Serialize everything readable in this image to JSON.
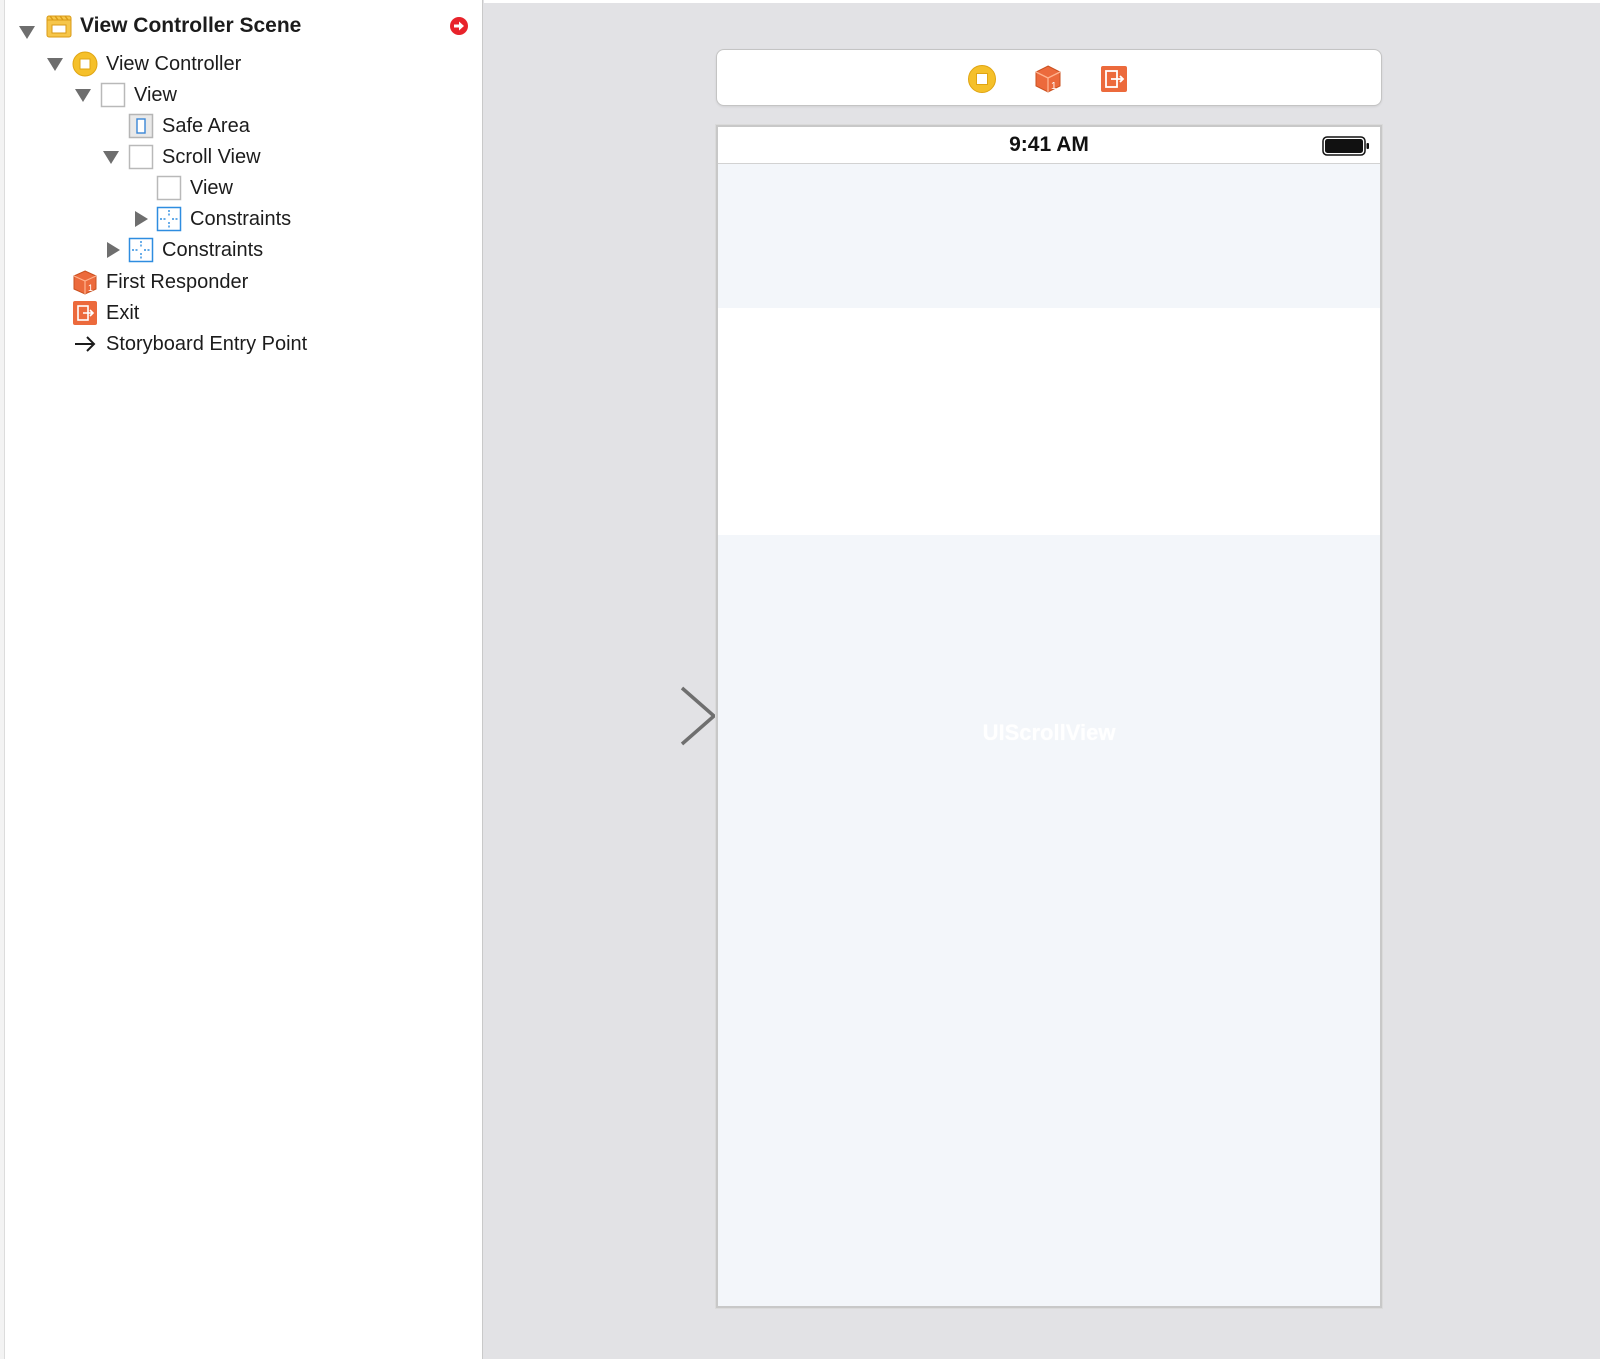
{
  "outline": {
    "scene_title": "View Controller Scene",
    "items": [
      {
        "label": "View Controller",
        "icon": "view-controller-icon"
      },
      {
        "label": "View",
        "icon": "view-icon"
      },
      {
        "label": "Safe Area",
        "icon": "safe-area-icon"
      },
      {
        "label": "Scroll View",
        "icon": "scroll-view-icon"
      },
      {
        "label": "View",
        "icon": "view-icon"
      },
      {
        "label": "Constraints",
        "icon": "constraints-icon"
      },
      {
        "label": "Constraints",
        "icon": "constraints-icon"
      },
      {
        "label": "First Responder",
        "icon": "first-responder-icon"
      },
      {
        "label": "Exit",
        "icon": "exit-icon"
      },
      {
        "label": "Storyboard Entry Point",
        "icon": "arrow-right-icon"
      }
    ]
  },
  "canvas": {
    "status_time": "9:41 AM",
    "watermark": "UIScrollView"
  },
  "colors": {
    "scene_icon": "#f2b632",
    "view_controller": "#f5c02a",
    "first_responder": "#ec6a3c",
    "exit": "#ec6a3c",
    "constraints": "#2e8de0",
    "warning": "#e8232b",
    "canvas_bg": "#e2e2e5",
    "scroll_bg": "#f3f6fa"
  }
}
